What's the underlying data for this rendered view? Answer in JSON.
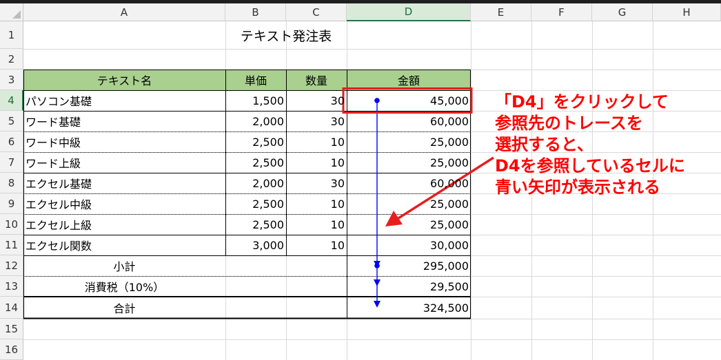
{
  "columns": [
    "A",
    "B",
    "C",
    "D",
    "E",
    "F",
    "G",
    "H"
  ],
  "selected_column": "D",
  "rows": [
    "1",
    "2",
    "3",
    "4",
    "5",
    "6",
    "7",
    "8",
    "9",
    "10",
    "11",
    "12",
    "13",
    "14",
    "15",
    "16"
  ],
  "selected_row": "4",
  "title": "テキスト発注表",
  "table": {
    "headers": [
      "テキスト名",
      "単価",
      "数量",
      "金額"
    ],
    "items": [
      {
        "name": "パソコン基礎",
        "price": "1,500",
        "qty": "30",
        "amount": "45,000"
      },
      {
        "name": "ワード基礎",
        "price": "2,000",
        "qty": "30",
        "amount": "60,000"
      },
      {
        "name": "ワード中級",
        "price": "2,500",
        "qty": "10",
        "amount": "25,000"
      },
      {
        "name": "ワード上級",
        "price": "2,500",
        "qty": "10",
        "amount": "25,000"
      },
      {
        "name": "エクセル基礎",
        "price": "2,000",
        "qty": "30",
        "amount": "60,000"
      },
      {
        "name": "エクセル中級",
        "price": "2,500",
        "qty": "10",
        "amount": "25,000"
      },
      {
        "name": "エクセル上級",
        "price": "2,500",
        "qty": "10",
        "amount": "25,000"
      },
      {
        "name": "エクセル関数",
        "price": "3,000",
        "qty": "10",
        "amount": "30,000"
      }
    ],
    "subtotal_label": "小計",
    "subtotal": "295,000",
    "tax_label": "消費税（10%）",
    "tax": "29,500",
    "total_label": "合計",
    "total": "324,500"
  },
  "annotation": {
    "lines": [
      "「D4」をクリックして",
      "参照先のトレースを",
      "選択すると、",
      "D4を参照しているセルに",
      "青い矢印が表示される"
    ],
    "color": "#ff0000"
  },
  "colors": {
    "header_fill": "#a9d08e",
    "selection": "#217346",
    "trace_arrow": "#0000ff",
    "highlight_box": "#e02020"
  }
}
